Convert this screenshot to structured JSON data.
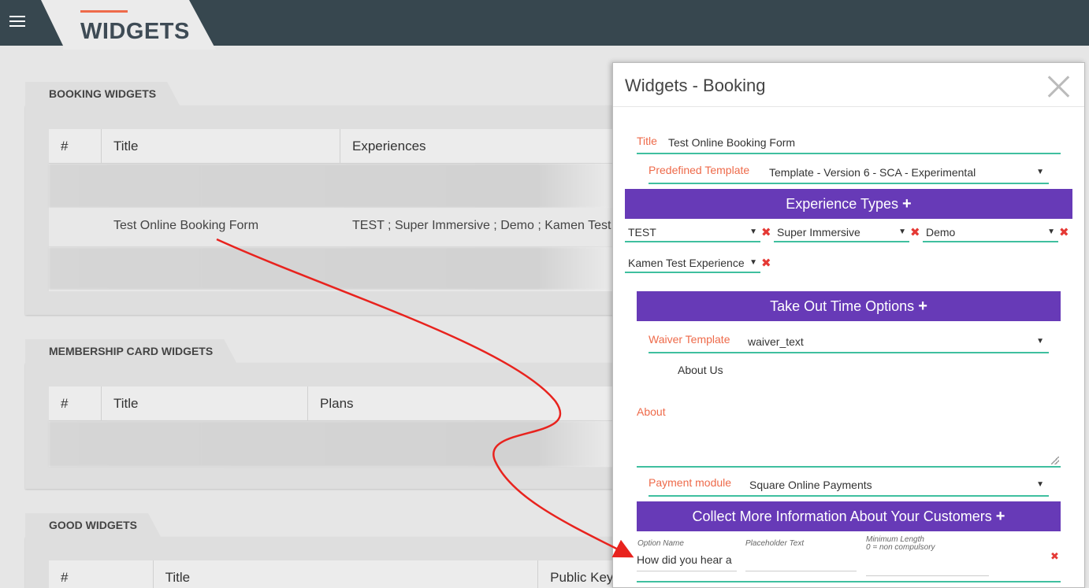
{
  "page": {
    "title": "WIDGETS"
  },
  "booking_panel": {
    "tab_label": "BOOKING WIDGETS",
    "columns": [
      "#",
      "Title",
      "Experiences"
    ],
    "row": {
      "title": "Test Online Booking Form",
      "experiences": "TEST ; Super Immersive ; Demo ; Kamen Test"
    }
  },
  "membership_panel": {
    "tab_label": "MEMBERSHIP CARD WIDGETS",
    "columns": [
      "#",
      "Title",
      "Plans"
    ]
  },
  "good_panel": {
    "tab_label": "GOOD WIDGETS",
    "columns": [
      "#",
      "Title",
      "Public Key"
    ]
  },
  "modal": {
    "title": "Widgets - Booking",
    "title_field": {
      "label": "Title",
      "value": "Test Online Booking Form"
    },
    "predefined_template": {
      "label": "Predefined Template",
      "value": "Template - Version 6 - SCA - Experimental"
    },
    "experience_types": {
      "header": "Experience Types",
      "plus": "+",
      "items": [
        "TEST",
        "Super Immersive",
        "Demo",
        "Kamen Test Experience"
      ]
    },
    "take_out": {
      "header": "Take Out Time Options",
      "plus": "+"
    },
    "waiver_template": {
      "label": "Waiver Template",
      "value": "waiver_text"
    },
    "about_us": "About Us",
    "about": {
      "label": "About",
      "value": ""
    },
    "payment_module": {
      "label": "Payment module",
      "value": "Square Online Payments"
    },
    "collect_info": {
      "header": "Collect More Information About Your Customers",
      "plus": "+",
      "option_name_label": "Option Name",
      "placeholder_label": "Placeholder Text",
      "min_length_label": "Minimum Length",
      "min_length_hint": "0 = non compulsory",
      "option_name_value": "How did you hear a"
    }
  },
  "colors": {
    "accent": "#ee6a4a",
    "purple": "#673ab7",
    "underline": "#3fbf9f",
    "topbar": "#37474f",
    "remove": "#e53935",
    "arrow": "#e8231e"
  },
  "icons": {
    "menu": "hamburger-icon",
    "close": "close-icon",
    "remove": "remove-x-icon",
    "dropdown": "caret-down-icon",
    "add": "plus-icon"
  }
}
